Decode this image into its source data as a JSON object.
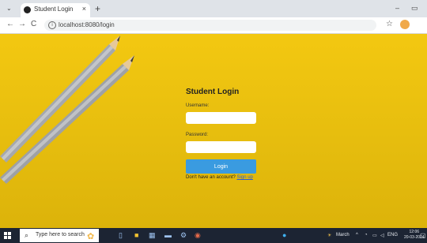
{
  "browser": {
    "tab_title": "Student Login",
    "tab_close": "×",
    "new_tab": "+",
    "url": "localhost:8080/login",
    "back": "←",
    "forward": "→",
    "reload": "C",
    "bookmark_star": "☆",
    "minimize": "–",
    "restore": "▭"
  },
  "login": {
    "title": "Student Login",
    "username_label": "Username:",
    "username_value": "",
    "password_label": "Password:",
    "password_value": "",
    "button_label": "Login",
    "signup_prompt": "Don't have an account?",
    "signup_link": "Sign up"
  },
  "taskbar": {
    "search_placeholder": "Type here to search",
    "weather_label": "March",
    "language": "ENG",
    "time": "12:06",
    "date": "20-03-2024"
  },
  "colors": {
    "page_background": "#e7c012",
    "login_button": "#3a9be0",
    "taskbar": "#1c2433",
    "signup_link": "#2a5cd4"
  }
}
